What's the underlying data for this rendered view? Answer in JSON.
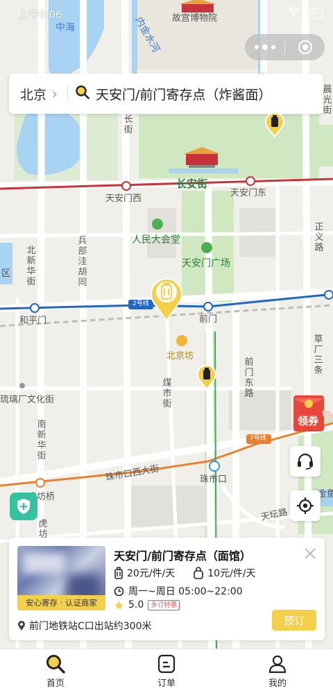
{
  "status_bar": {
    "time": "上午9:06",
    "battery": "55"
  },
  "search": {
    "city": "北京",
    "query": "天安门/前门寄存点（炸酱面）"
  },
  "map_labels": {
    "zhonghai": "中海",
    "gugong": "故宫博物院",
    "neijinshuihe": "内金水河",
    "nanchang": "南长街",
    "changanjie": "长安街",
    "tiananmenxi": "天安门西",
    "tiananmendong": "天安门东",
    "renmindahuitang": "人民大会堂",
    "tiananmenguangchang": "天安门广场",
    "bingbu": "兵部洼胡同",
    "beixinhua": "北新华街",
    "qu": "区",
    "hepingmen": "和平门",
    "line2": "2号线",
    "qianmen": "前门",
    "beijingfang": "北京坊",
    "meishijie": "煤市街",
    "qianmendonglu": "前门东路",
    "liulichang": "琉璃厂文化街",
    "nanxinhua": "南新华街",
    "line7": "7号线",
    "zhushikouxi": "珠市口西大街",
    "zhushikou": "珠市口",
    "hufangqiao": "虎坊桥",
    "hufang": "虎坊",
    "tiantanlu": "天坛路",
    "zhengyi": "正义路",
    "caochangsitiao": "草厂三条",
    "dongguang": "晨光街",
    "jinyu": "金鱼"
  },
  "coupon": {
    "label": "领券"
  },
  "store": {
    "name": "天安门/前门寄存点（面馆）",
    "badge": "安心寄存 · 认证商家",
    "price_large": "20元/件/天",
    "price_small": "10元/件/天",
    "hours": "周一~周日 05:00~22:00",
    "rating": "5.0",
    "promo_tag": "多订特惠",
    "address": "前门地铁站C口出站约300米",
    "book_label": "预订"
  },
  "tabs": [
    {
      "label": "首页",
      "icon": "search-icon",
      "active": true
    },
    {
      "label": "订单",
      "icon": "order-icon",
      "active": false
    },
    {
      "label": "我的",
      "icon": "user-icon",
      "active": false
    }
  ],
  "colors": {
    "accent": "#f3cf4a",
    "line2": "#1f67c4",
    "line1": "#c8323a",
    "line7": "#e8802f",
    "park": "#cfe8c2",
    "water": "#a9d3f2"
  }
}
